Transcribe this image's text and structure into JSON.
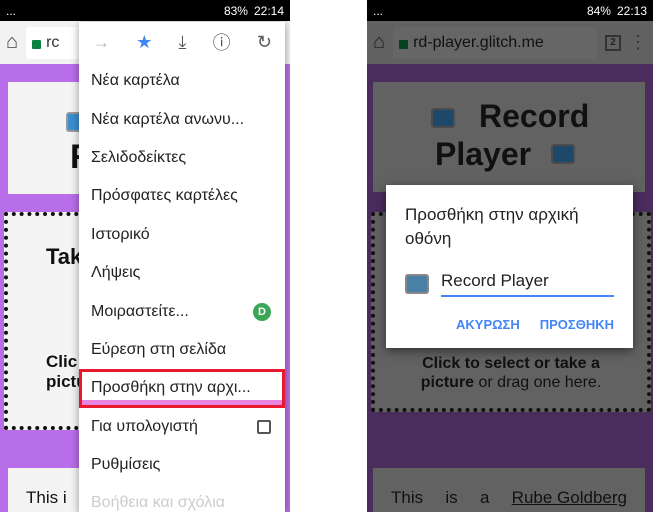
{
  "left": {
    "status": {
      "dots": "...",
      "battery": "83%",
      "time": "22:14"
    },
    "url_fragment": "rc",
    "page": {
      "title_fragment": "R",
      "take_fragment": "Tak",
      "click_fragment": "Clic",
      "picture_fragment": "pictu",
      "this_fragment": "This i"
    },
    "menu": {
      "icons": [
        "forward-icon",
        "star-icon",
        "download-icon",
        "info-icon",
        "reload-icon"
      ],
      "items": [
        {
          "label": "Νέα καρτέλα"
        },
        {
          "label": "Νέα καρτέλα ανωνυ..."
        },
        {
          "label": "Σελιδοδείκτες"
        },
        {
          "label": "Πρόσφατες καρτέλες"
        },
        {
          "label": "Ιστορικό"
        },
        {
          "label": "Λήψεις"
        },
        {
          "label": "Μοιραστείτε..."
        },
        {
          "label": "Εύρεση στη σελίδα"
        },
        {
          "label": "Προσθήκη στην αρχι...",
          "highlighted": true
        },
        {
          "label": "Για υπολογιστή",
          "checkbox": false
        },
        {
          "label": "Ρυθμίσεις"
        },
        {
          "label": "Βοήθεια και σχόλια"
        }
      ]
    }
  },
  "right": {
    "status": {
      "dots": "...",
      "battery": "84%",
      "time": "22:13"
    },
    "url": "rd-player.glitch.me",
    "tab_count": "2",
    "page": {
      "title_line1": "Record",
      "title_line2": "Player",
      "click_bold": "Click to select or take a",
      "picture_bold": "picture",
      "drag_text": " or drag one here.",
      "this": "This",
      "is": "is",
      "a": "a",
      "link": "Rube Goldberg"
    },
    "dialog": {
      "title": "Προσθήκη στην αρχική οθόνη",
      "input_value": "Record Player",
      "cancel": "ΑΚΥΡΩΣΗ",
      "add": "ΠΡΟΣΘΗΚΗ"
    }
  },
  "colors": {
    "accent": "#4285f4",
    "highlight": "#e8192c",
    "page_bg": "#b86ee8"
  }
}
